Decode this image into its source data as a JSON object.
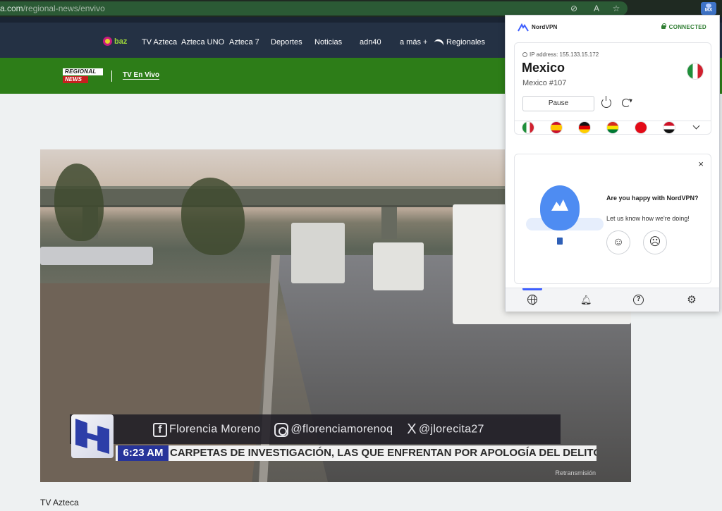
{
  "browser": {
    "url_host": "a.com",
    "url_path": "/regional-news/envivo",
    "extension_badge": "MX"
  },
  "site_nav": {
    "baz_label": "baz",
    "items": [
      "TV Azteca",
      "Azteca UNO",
      "Azteca 7",
      "Deportes",
      "Noticias",
      "adn40",
      "a más +",
      "Regionales"
    ]
  },
  "sub_header": {
    "logo_line1": "REGIONAL",
    "logo_line2": "NEWS",
    "link": "TV En Vivo"
  },
  "video": {
    "lower_third": {
      "facebook_name": "Florencia Moreno",
      "instagram_handle": "@florenciamorenoq",
      "x_handle": "@jlorecita27"
    },
    "time": "6:23 AM",
    "ticker": "CARPETAS DE INVESTIGACIÓN, LAS QUE ENFRENTAN POR APOLOGÍA  DEL DELITO *** AUM",
    "watermark": "Retransmisión"
  },
  "page": {
    "caption": "TV Azteca"
  },
  "nordvpn": {
    "brand": "NordVPN",
    "status": "CONNECTED",
    "status_color": "#2e7d31",
    "ip_label": "IP address: 155.133.15.172",
    "country": "Mexico",
    "server": "Mexico #107",
    "pause_label": "Pause",
    "quick_flags": [
      "mexico",
      "spain",
      "germany",
      "bolivia",
      "turkey",
      "egypt"
    ],
    "survey": {
      "question": "Are you happy with NordVPN?",
      "subtitle": "Let us know how we're doing!"
    },
    "footer_tabs": [
      "globe-icon",
      "bell-icon",
      "help-icon",
      "settings-icon"
    ]
  }
}
